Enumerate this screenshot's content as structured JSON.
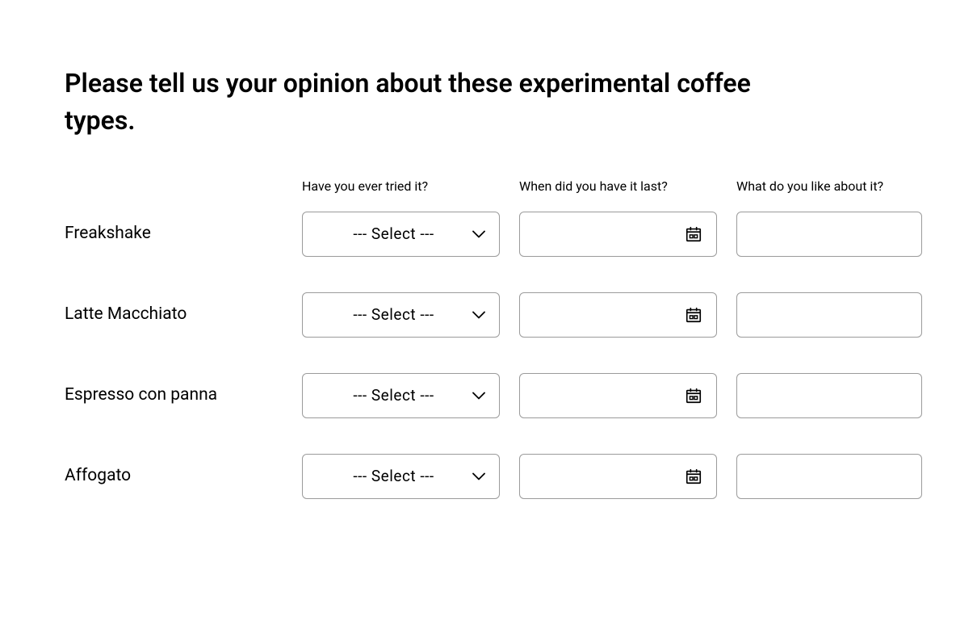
{
  "heading": "Please tell us your opinion about these experimental coffee types.",
  "columns": {
    "tried": "Have you ever tried it?",
    "last": "When did you have it last?",
    "like": "What do you like about it?"
  },
  "select_placeholder": "---  Select  ---",
  "rows": [
    {
      "label": "Freakshake"
    },
    {
      "label": "Latte Macchiato"
    },
    {
      "label": "Espresso con panna"
    },
    {
      "label": "Affogato"
    }
  ]
}
